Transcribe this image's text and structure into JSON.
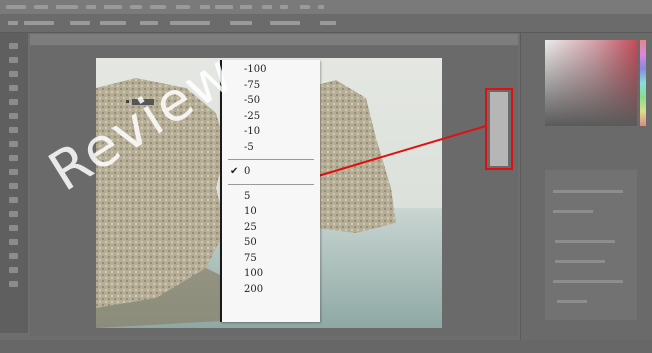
{
  "watermark": {
    "text": "Review"
  },
  "zoom_menu": {
    "items": [
      {
        "label": "-100",
        "checked": false
      },
      {
        "label": "-75",
        "checked": false
      },
      {
        "label": "-50",
        "checked": false
      },
      {
        "label": "-25",
        "checked": false
      },
      {
        "label": "-10",
        "checked": false
      },
      {
        "label": "-5",
        "checked": false
      },
      {
        "label": "0",
        "checked": true
      },
      {
        "label": "5",
        "checked": false
      },
      {
        "label": "10",
        "checked": false
      },
      {
        "label": "25",
        "checked": false
      },
      {
        "label": "50",
        "checked": false
      },
      {
        "label": "75",
        "checked": false
      },
      {
        "label": "100",
        "checked": false
      },
      {
        "label": "200",
        "checked": false
      }
    ],
    "check_symbol": "✔"
  },
  "colors": {
    "highlight": "#e01010",
    "menu_bg": "#f7f7f7",
    "chrome": "#6e6e6e"
  }
}
